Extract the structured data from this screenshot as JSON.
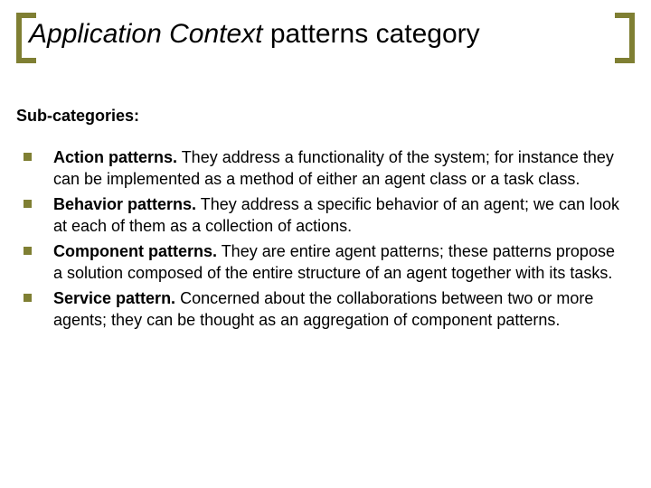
{
  "title": {
    "italic_part": "Application Context",
    "rest_part": " patterns category"
  },
  "subhead": "Sub-categories:",
  "items": [
    {
      "lead": "Action patterns.",
      "rest": " They address a functionality of the system; for instance they can be implemented as a method of either an agent class or a task class."
    },
    {
      "lead": "Behavior patterns.",
      "rest": " They address a specific behavior of an agent; we can look at each of them as a collection of actions."
    },
    {
      "lead": "Component patterns.",
      "rest": " They are entire agent patterns; these patterns propose a solution composed of the entire structure of an agent together with its tasks."
    },
    {
      "lead": "Service pattern.",
      "rest": " Concerned about the collaborations between two or more agents; they can be thought as an aggregation of component patterns."
    }
  ]
}
